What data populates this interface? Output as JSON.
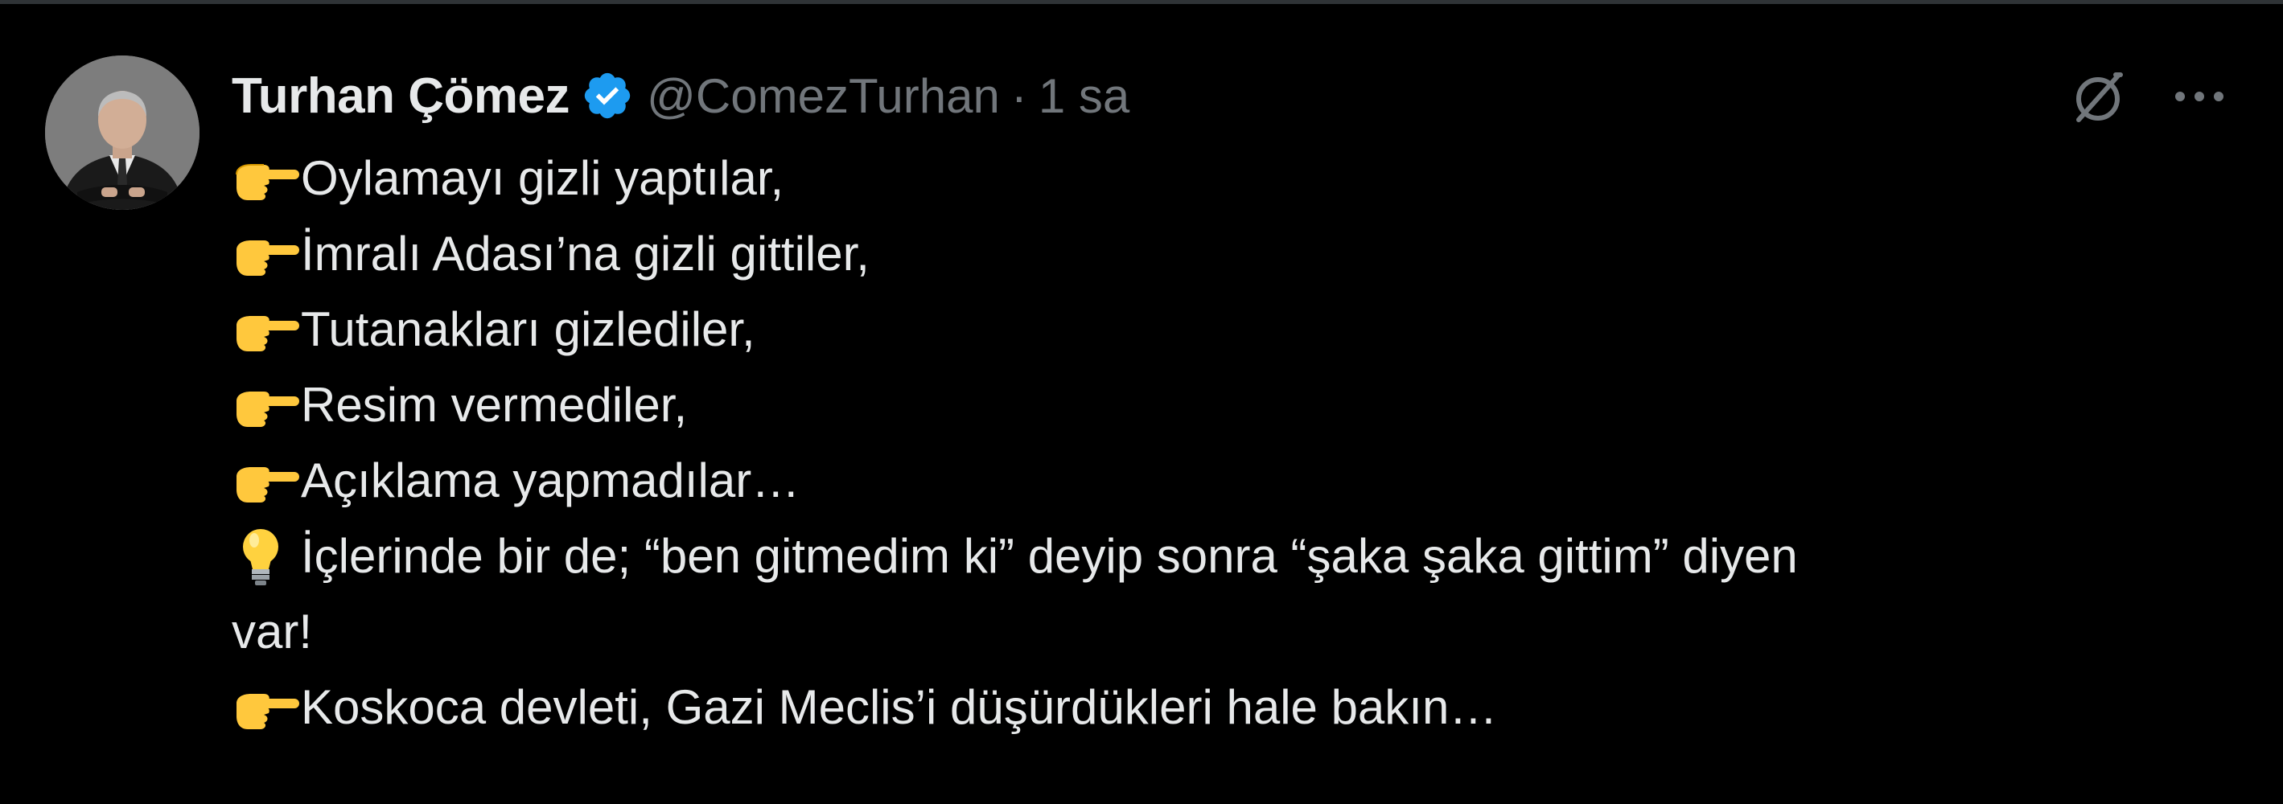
{
  "tweet": {
    "author": {
      "display_name": "Turhan Çömez",
      "handle": "@ComezTurhan",
      "separator": "·",
      "time": "1 sa"
    },
    "icons": {
      "verified": "verified-badge-icon",
      "grok": "grok-icon",
      "more": "more-options-icon",
      "pointing": "backhand-index-pointing-right-icon",
      "bulb": "light-bulb-icon"
    },
    "colors": {
      "background": "#000000",
      "text": "#e7e9ea",
      "secondary": "#71767b",
      "verified": "#1d9bf0",
      "emoji_hand": "#ffc83d"
    },
    "lines": [
      "Oylamayı gizli yaptılar,",
      "İmralı Adası’na gizli gittiler,",
      "Tutanakları gizlediler,",
      "Resim vermediler,",
      "Açıklama yapmadılar…",
      "İçlerinde bir de; “ben gitmedim ki” deyip sonra “şaka şaka gittim” diyen",
      "var!",
      "Koskoca devleti, Gazi Meclis’i düşürdükleri hale bakın…"
    ]
  }
}
